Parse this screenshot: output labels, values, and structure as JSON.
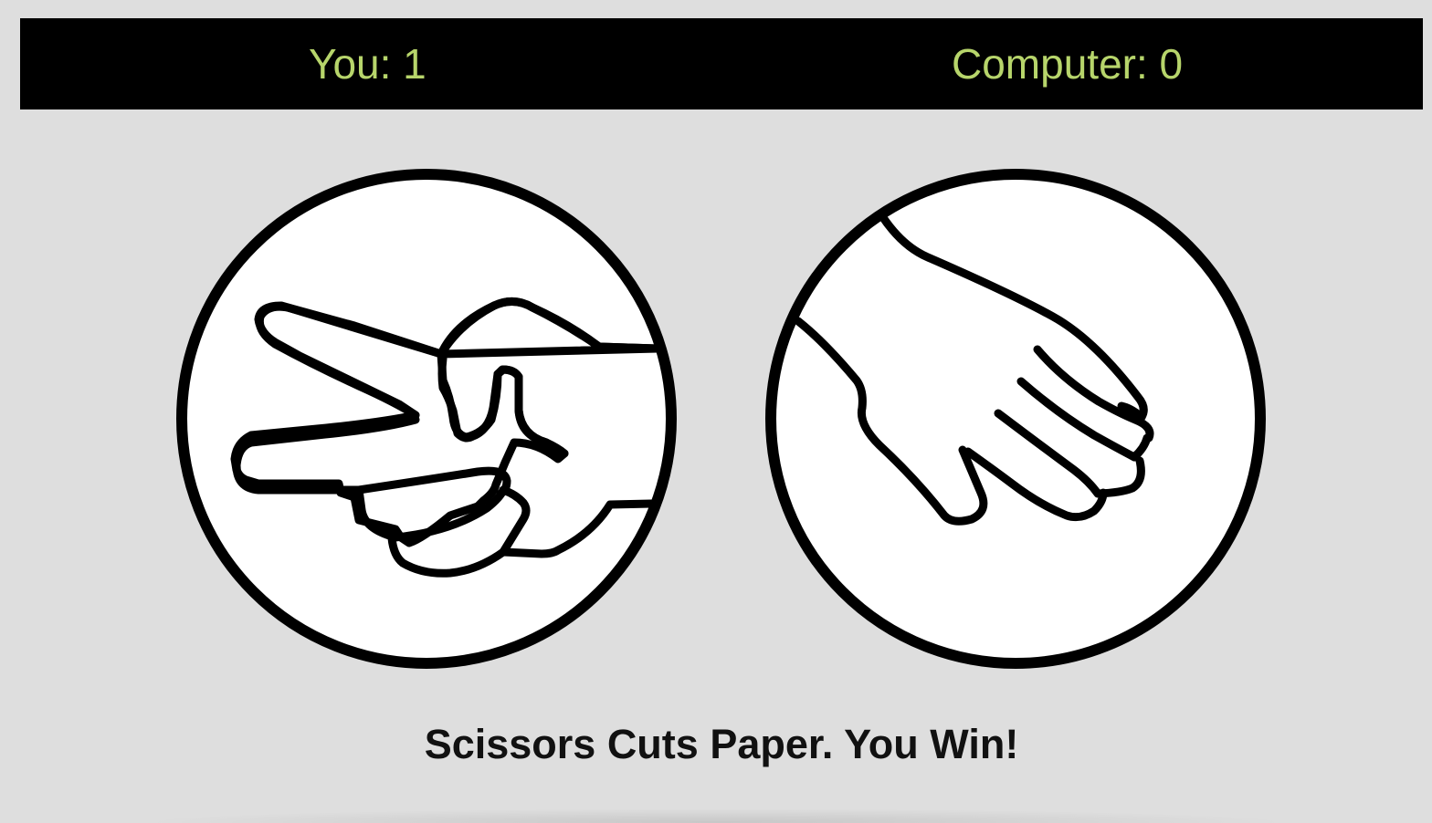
{
  "scoreboard": {
    "user_score": "You: 1",
    "computer_score": "Computer: 0"
  },
  "choices": {
    "user": {
      "icon": "scissors-hand-icon"
    },
    "computer": {
      "icon": "paper-hand-icon"
    }
  },
  "result_message": "Scissors Cuts Paper. You Win!",
  "colors": {
    "background": "#dedede",
    "scoreboard_bg": "#000000",
    "score_text": "#b7d56b",
    "circle_fill": "#ffffff",
    "outline": "#000000",
    "message_text": "#111111"
  }
}
